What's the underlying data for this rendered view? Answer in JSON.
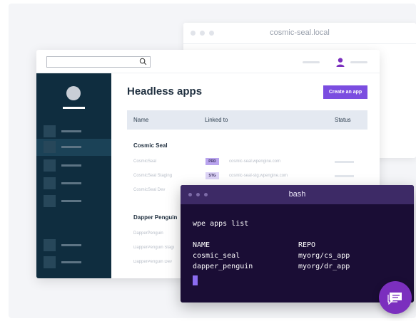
{
  "back_window": {
    "title": "cosmic-seal.local"
  },
  "app": {
    "search": {
      "placeholder": "",
      "icon": "search-icon"
    },
    "page_title": "Headless apps",
    "create_button": "Create an app",
    "columns": [
      "Name",
      "Linked to",
      "Status"
    ],
    "groups": [
      {
        "name": "Cosmic Seal",
        "rows": [
          {
            "name": "CosmicSeal",
            "env": "PRD",
            "url": "cosmic-seal.wpengine.com"
          },
          {
            "name": "CosmicSeal Staging",
            "env": "STG",
            "url": "cosmic-seal-stg.wpengine.com"
          },
          {
            "name": "CosmicSeal Dev",
            "env": "",
            "url": ""
          }
        ]
      },
      {
        "name": "Dapper Penguin",
        "rows": [
          {
            "name": "DapperPenguin"
          },
          {
            "name": "DapperPenguin Stagi"
          },
          {
            "name": "DapperPenguin Dev"
          }
        ]
      }
    ]
  },
  "terminal": {
    "title": "bash",
    "command": "wpe apps list",
    "header": {
      "name": "NAME",
      "repo": "REPO"
    },
    "rows": [
      {
        "name": "cosmic_seal",
        "repo": "myorg/cs_app"
      },
      {
        "name": "dapper_penguin",
        "repo": "myorg/dr_app"
      }
    ]
  },
  "chat": {
    "icon": "chat-icon"
  },
  "colors": {
    "sidebar": "#0f2d3f",
    "accent": "#7b4de0",
    "terminal_bg": "#1a0d35",
    "terminal_bar": "#3d2a66",
    "chat": "#7b2fbe"
  }
}
